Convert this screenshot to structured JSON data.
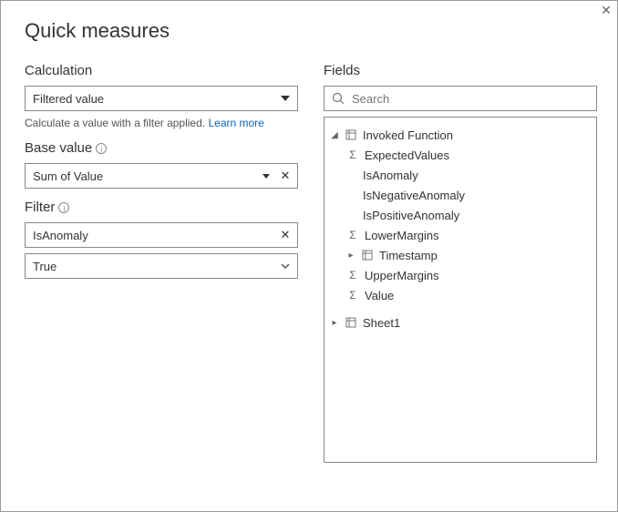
{
  "title": "Quick measures",
  "left": {
    "calculation_header": "Calculation",
    "calculation_value": "Filtered value",
    "helper_text": "Calculate a value with a filter applied.",
    "learn_more": "Learn more",
    "base_value_header": "Base value",
    "base_value": "Sum of Value",
    "filter_header": "Filter",
    "filter_field": "IsAnomaly",
    "filter_value": "True"
  },
  "right": {
    "fields_header": "Fields",
    "search_placeholder": "Search",
    "tree": {
      "table1": "Invoked Function",
      "f1": "ExpectedValues",
      "f2": "IsAnomaly",
      "f3": "IsNegativeAnomaly",
      "f4": "IsPositiveAnomaly",
      "f5": "LowerMargins",
      "f6": "Timestamp",
      "f7": "UpperMargins",
      "f8": "Value",
      "table2": "Sheet1"
    }
  }
}
